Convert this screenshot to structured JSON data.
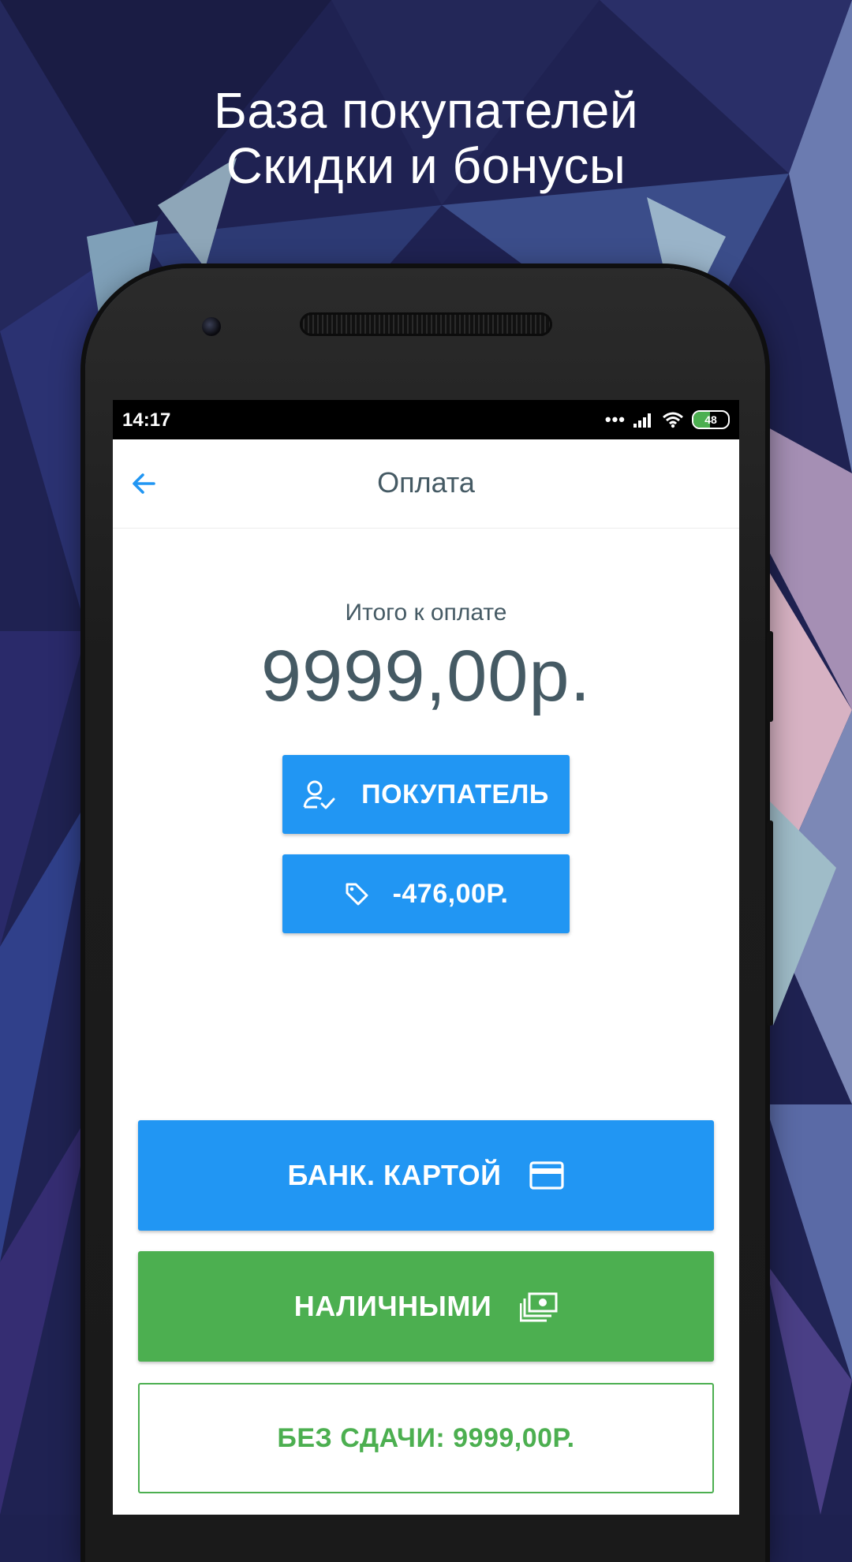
{
  "promo": {
    "line1": "База покупателей",
    "line2": "Скидки и бонусы"
  },
  "status_bar": {
    "time": "14:17",
    "battery": "48"
  },
  "app_bar": {
    "title": "Оплата",
    "back_icon": "arrow-left-icon"
  },
  "payment": {
    "total_label": "Итого к оплате",
    "total_value": "9999,00р.",
    "customer_button": "ПОКУПАТЕЛЬ",
    "discount_button": "-476,00Р.",
    "card_button": "БАНК. КАРТОЙ",
    "cash_button": "НАЛИЧНЫМИ",
    "no_change_button": "БЕЗ СДАЧИ: 9999,00Р."
  },
  "colors": {
    "accent_blue": "#2196f3",
    "accent_green": "#4caf50",
    "text_dark": "#455a64"
  }
}
